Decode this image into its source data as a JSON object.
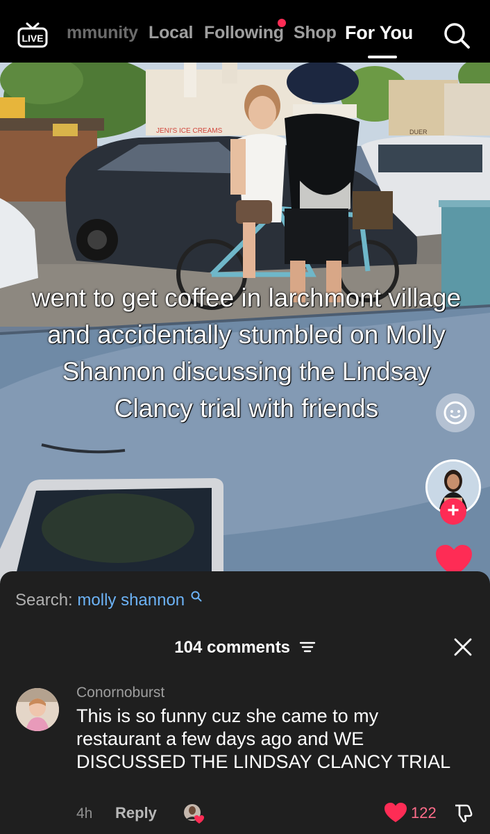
{
  "top_nav": {
    "live_label": "LIVE",
    "tabs": [
      {
        "label": "mmunity",
        "active": false
      },
      {
        "label": "Local",
        "active": false
      },
      {
        "label": "Following",
        "active": false,
        "has_notification_dot": true
      },
      {
        "label": "Shop",
        "active": false
      },
      {
        "label": "For You",
        "active": true
      }
    ],
    "search_icon": "search-icon"
  },
  "video": {
    "caption": "went to get coffee in larchmont village and accidentally stumbled on Molly Shannon discussing the Lindsay Clancy trial with friends",
    "storefront_signs": [
      "JENI'S ICE CREAMS",
      "DUER"
    ]
  },
  "right_rail": {
    "emoji_icon": "smiling-face-icon",
    "follow_icon": "plus-icon",
    "like_icon": "heart-icon",
    "like_color": "#fe2c55"
  },
  "comments_sheet": {
    "search_label": "Search:",
    "search_query": "molly shannon",
    "comments_count": "104 comments",
    "filter_icon": "sort-filter-icon",
    "close_icon": "close-icon",
    "comment": {
      "username": "Conornoburst",
      "text": "This is so funny cuz she came to my restaurant a few days ago and WE DISCUSSED THE LINDSAY CLANCY TRIAL",
      "time": "4h",
      "reply_label": "Reply",
      "like_count": "122",
      "liked": true
    }
  },
  "colors": {
    "accent": "#fe2c55",
    "sheet_background": "#1f1f1f",
    "search_link": "#6cb2f5"
  }
}
